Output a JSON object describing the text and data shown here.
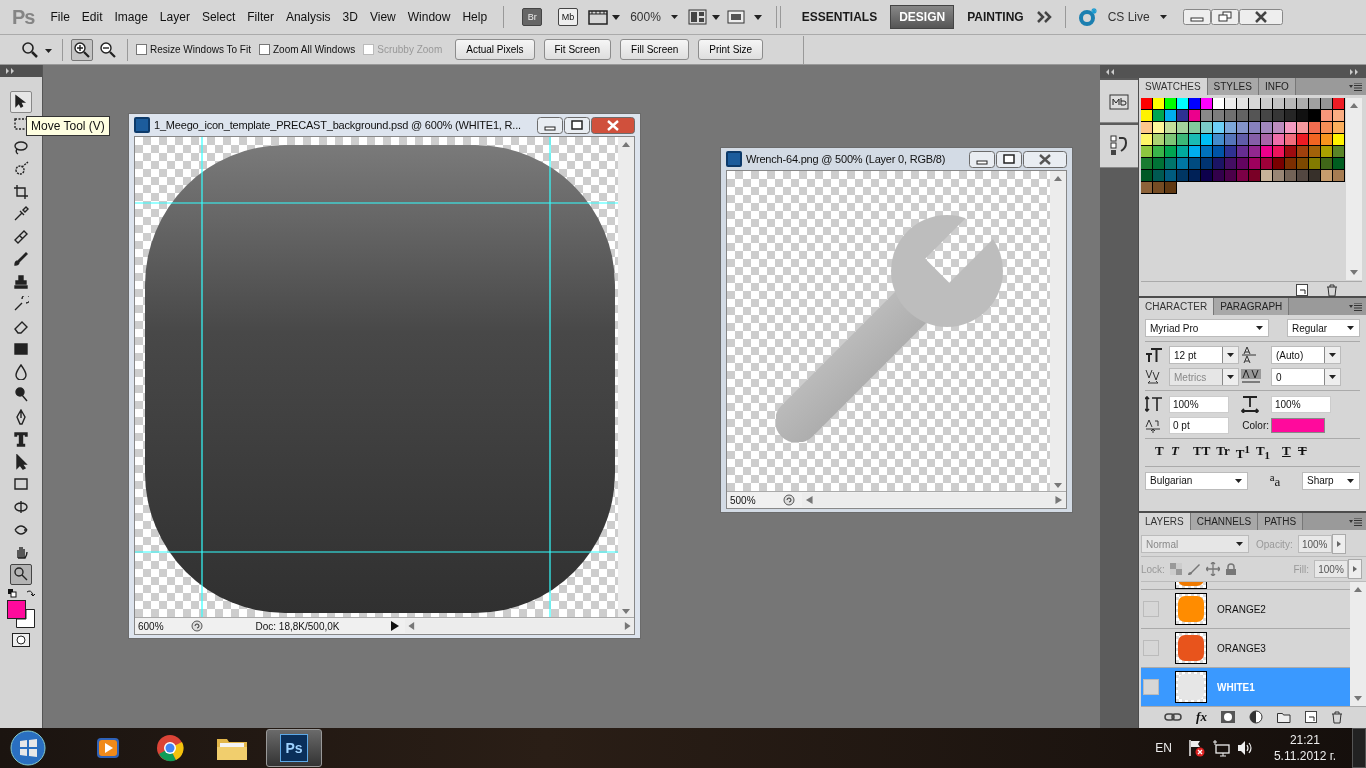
{
  "menubar": {
    "logo": "Ps",
    "menus": [
      "File",
      "Edit",
      "Image",
      "Layer",
      "Select",
      "Filter",
      "Analysis",
      "3D",
      "View",
      "Window",
      "Help"
    ],
    "bridge": "Br",
    "mini_bridge": "Mb",
    "zoom": "600%",
    "workspaces": [
      {
        "label": "ESSENTIALS",
        "selected": false
      },
      {
        "label": "DESIGN",
        "selected": true
      },
      {
        "label": "PAINTING",
        "selected": false
      }
    ],
    "cs_live": "CS Live"
  },
  "options_bar": {
    "zoom_modes": [
      {
        "kind": "zoom-in",
        "selected": true
      },
      {
        "kind": "zoom-out",
        "selected": false
      }
    ],
    "checkboxes": [
      {
        "label": "Resize Windows To Fit",
        "checked": false,
        "disabled": false
      },
      {
        "label": "Zoom All Windows",
        "checked": false,
        "disabled": false
      },
      {
        "label": "Scrubby Zoom",
        "checked": false,
        "disabled": true
      }
    ],
    "buttons": [
      "Actual Pixels",
      "Fit Screen",
      "Fill Screen",
      "Print Size"
    ]
  },
  "tools": [
    {
      "kind": "move",
      "selected": false,
      "hovered": true
    },
    {
      "kind": "marquee",
      "selected": false,
      "hovered": false
    },
    {
      "kind": "lasso",
      "selected": false,
      "hovered": false
    },
    {
      "kind": "quick-select",
      "selected": false,
      "hovered": false
    },
    {
      "kind": "crop",
      "selected": false,
      "hovered": false
    },
    {
      "kind": "eyedropper",
      "selected": false,
      "hovered": false
    },
    {
      "kind": "healing",
      "selected": false,
      "hovered": false
    },
    {
      "kind": "brush",
      "selected": false,
      "hovered": false
    },
    {
      "kind": "stamp",
      "selected": false,
      "hovered": false
    },
    {
      "kind": "history-brush",
      "selected": false,
      "hovered": false
    },
    {
      "kind": "eraser",
      "selected": false,
      "hovered": false
    },
    {
      "kind": "gradient",
      "selected": false,
      "hovered": false
    },
    {
      "kind": "blur",
      "selected": false,
      "hovered": false
    },
    {
      "kind": "dodge",
      "selected": false,
      "hovered": false
    },
    {
      "kind": "pen",
      "selected": false,
      "hovered": false
    },
    {
      "kind": "type",
      "selected": false,
      "hovered": false
    },
    {
      "kind": "path-select",
      "selected": false,
      "hovered": false
    },
    {
      "kind": "shape",
      "selected": false,
      "hovered": false
    },
    {
      "kind": "rotate3d",
      "selected": false,
      "hovered": false
    },
    {
      "kind": "orbit3d",
      "selected": false,
      "hovered": false
    },
    {
      "kind": "hand",
      "selected": false,
      "hovered": false
    },
    {
      "kind": "zoom",
      "selected": true,
      "hovered": false
    }
  ],
  "tooltip": "Move Tool (V)",
  "colors": [
    {
      "kind": "foreground",
      "color": "#ff0a9c"
    },
    {
      "kind": "background",
      "color": "#ffffff"
    }
  ],
  "documents": [
    {
      "kind": "rounded-square",
      "title": "1_Meego_icon_template_PRECAST_background.psd @ 600% (WHITE1, R...",
      "zoom": "600%",
      "doc_info": "Doc: 18,8K/500,0K",
      "active": true
    },
    {
      "kind": "wrench",
      "title": "Wrench-64.png @ 500% (Layer 0, RGB/8)",
      "zoom": "500%",
      "active": false
    }
  ],
  "swatches_panel": {
    "tabs": [
      {
        "label": "SWATCHES",
        "selected": true
      },
      {
        "label": "STYLES",
        "selected": false
      },
      {
        "label": "INFO",
        "selected": false
      }
    ],
    "swatches": [
      {
        "color": "#ff0000"
      },
      {
        "color": "#ffff00"
      },
      {
        "color": "#00ff00"
      },
      {
        "color": "#00ffff"
      },
      {
        "color": "#0000ff"
      },
      {
        "color": "#ff00ff"
      },
      {
        "color": "#ffffff"
      },
      {
        "color": "#ebebeb"
      },
      {
        "color": "#e1e1e1"
      },
      {
        "color": "#d7d7d7"
      },
      {
        "color": "#cccccc"
      },
      {
        "color": "#c2c2c2"
      },
      {
        "color": "#b7b7b7"
      },
      {
        "color": "#acacac"
      },
      {
        "color": "#a0a0a0"
      },
      {
        "color": "#959595"
      },
      {
        "color": "#ed1c24"
      },
      {
        "color": "#fff200"
      },
      {
        "color": "#00a651"
      },
      {
        "color": "#00aeef"
      },
      {
        "color": "#2e3192"
      },
      {
        "color": "#ec008c"
      },
      {
        "color": "#898989"
      },
      {
        "color": "#7d7d7d"
      },
      {
        "color": "#707070"
      },
      {
        "color": "#636363"
      },
      {
        "color": "#555555"
      },
      {
        "color": "#464646"
      },
      {
        "color": "#363636"
      },
      {
        "color": "#262626"
      },
      {
        "color": "#111111"
      },
      {
        "color": "#000000"
      },
      {
        "color": "#f7977a"
      },
      {
        "color": "#fbad82"
      },
      {
        "color": "#fdc68a"
      },
      {
        "color": "#fff799"
      },
      {
        "color": "#c4df9b"
      },
      {
        "color": "#a3d39c"
      },
      {
        "color": "#82ca9c"
      },
      {
        "color": "#7accc8"
      },
      {
        "color": "#6dcff6"
      },
      {
        "color": "#7da7d9"
      },
      {
        "color": "#8393ca"
      },
      {
        "color": "#8781bd"
      },
      {
        "color": "#a187be"
      },
      {
        "color": "#bd8cbf"
      },
      {
        "color": "#f49ac1"
      },
      {
        "color": "#f6989d"
      },
      {
        "color": "#f26c4f"
      },
      {
        "color": "#f68e56"
      },
      {
        "color": "#fbaf5d"
      },
      {
        "color": "#fff568"
      },
      {
        "color": "#acd373"
      },
      {
        "color": "#7cc576"
      },
      {
        "color": "#3bb878"
      },
      {
        "color": "#1abbb4"
      },
      {
        "color": "#00bff3"
      },
      {
        "color": "#448ccb"
      },
      {
        "color": "#5574b9"
      },
      {
        "color": "#605ca8"
      },
      {
        "color": "#855fa8"
      },
      {
        "color": "#a864a8"
      },
      {
        "color": "#f06eaa"
      },
      {
        "color": "#f26d7d"
      },
      {
        "color": "#ed1c24"
      },
      {
        "color": "#f26522"
      },
      {
        "color": "#f7941d"
      },
      {
        "color": "#fff200"
      },
      {
        "color": "#8dc63f"
      },
      {
        "color": "#39b54a"
      },
      {
        "color": "#00a651"
      },
      {
        "color": "#00a99d"
      },
      {
        "color": "#00aeef"
      },
      {
        "color": "#0072bc"
      },
      {
        "color": "#0054a6"
      },
      {
        "color": "#2e3192"
      },
      {
        "color": "#662d91"
      },
      {
        "color": "#92278f"
      },
      {
        "color": "#ec008c"
      },
      {
        "color": "#ed145b"
      },
      {
        "color": "#9e0b0f"
      },
      {
        "color": "#a0410d"
      },
      {
        "color": "#a36209"
      },
      {
        "color": "#aba000"
      },
      {
        "color": "#598527"
      },
      {
        "color": "#197b30"
      },
      {
        "color": "#007236"
      },
      {
        "color": "#00746b"
      },
      {
        "color": "#0076a3"
      },
      {
        "color": "#004b80"
      },
      {
        "color": "#003471"
      },
      {
        "color": "#1b1464"
      },
      {
        "color": "#440e62"
      },
      {
        "color": "#630460"
      },
      {
        "color": "#9e005d"
      },
      {
        "color": "#9e0039"
      },
      {
        "color": "#790000"
      },
      {
        "color": "#7b2e00"
      },
      {
        "color": "#7d4900"
      },
      {
        "color": "#827b00"
      },
      {
        "color": "#406618"
      },
      {
        "color": "#005e20"
      },
      {
        "color": "#005826"
      },
      {
        "color": "#005952"
      },
      {
        "color": "#005b7f"
      },
      {
        "color": "#003663"
      },
      {
        "color": "#002157"
      },
      {
        "color": "#0d004c"
      },
      {
        "color": "#32004b"
      },
      {
        "color": "#4b0049"
      },
      {
        "color": "#7b0046"
      },
      {
        "color": "#7a0026"
      },
      {
        "color": "#c7b299"
      },
      {
        "color": "#998675"
      },
      {
        "color": "#736357"
      },
      {
        "color": "#534741"
      },
      {
        "color": "#37302a"
      },
      {
        "color": "#c69c6d"
      },
      {
        "color": "#a67c52"
      },
      {
        "color": "#8c6239"
      },
      {
        "color": "#754c24"
      },
      {
        "color": "#603913"
      }
    ]
  },
  "character_panel": {
    "tabs": [
      {
        "label": "CHARACTER",
        "selected": true
      },
      {
        "label": "PARAGRAPH",
        "selected": false
      }
    ],
    "font_family": "Myriad Pro",
    "font_style": "Regular",
    "size": "12 pt",
    "leading": "(Auto)",
    "kerning": "Metrics",
    "tracking": "0",
    "vertical_scale": "100%",
    "horizontal_scale": "100%",
    "baseline_shift": "0 pt",
    "color_label": "Color:",
    "color": "#ff0a9c",
    "style_buttons": [
      {
        "kind": "bold",
        "label": "T"
      },
      {
        "kind": "italic",
        "label": "T"
      },
      {
        "kind": "caps",
        "label": "TT"
      },
      {
        "kind": "small-caps",
        "label": "Tr"
      },
      {
        "kind": "superscript",
        "label": "T$^{1}$"
      },
      {
        "kind": "subscript",
        "label": "T$_{1}$"
      },
      {
        "kind": "underline",
        "label": "T"
      },
      {
        "kind": "strikethrough",
        "label": "T"
      }
    ],
    "language": "Bulgarian",
    "antialias_glyph": "$^{a}$a",
    "antialias": "Sharp"
  },
  "layers_panel": {
    "tabs": [
      {
        "label": "LAYERS",
        "selected": true
      },
      {
        "label": "CHANNELS",
        "selected": false
      },
      {
        "label": "PATHS",
        "selected": false
      }
    ],
    "blend_mode": "Normal",
    "opacity_label": "Opacity:",
    "opacity": "100%",
    "lock_label": "Lock:",
    "fill_label": "Fill:",
    "fill": "100%",
    "layers": [
      {
        "color": "#f07a00",
        "selected": false
      },
      {
        "name": "ORANGE2",
        "color": "#ff8c00",
        "visible": false,
        "selected": false
      },
      {
        "name": "ORANGE3",
        "color": "#e8541c",
        "visible": false,
        "selected": false
      },
      {
        "name": "WHITE1",
        "color": "#e6e6e6",
        "visible": false,
        "selected": true
      }
    ],
    "fx_label": "fx"
  },
  "taskbar": {
    "apps": [
      {
        "kind": "media",
        "selected": false
      },
      {
        "kind": "browser",
        "selected": false
      },
      {
        "kind": "folder",
        "selected": false
      },
      {
        "kind": "photoshop",
        "label": "Ps",
        "selected": true
      }
    ],
    "language": "EN",
    "time": "21:21",
    "date": "5.11.2012 г."
  }
}
